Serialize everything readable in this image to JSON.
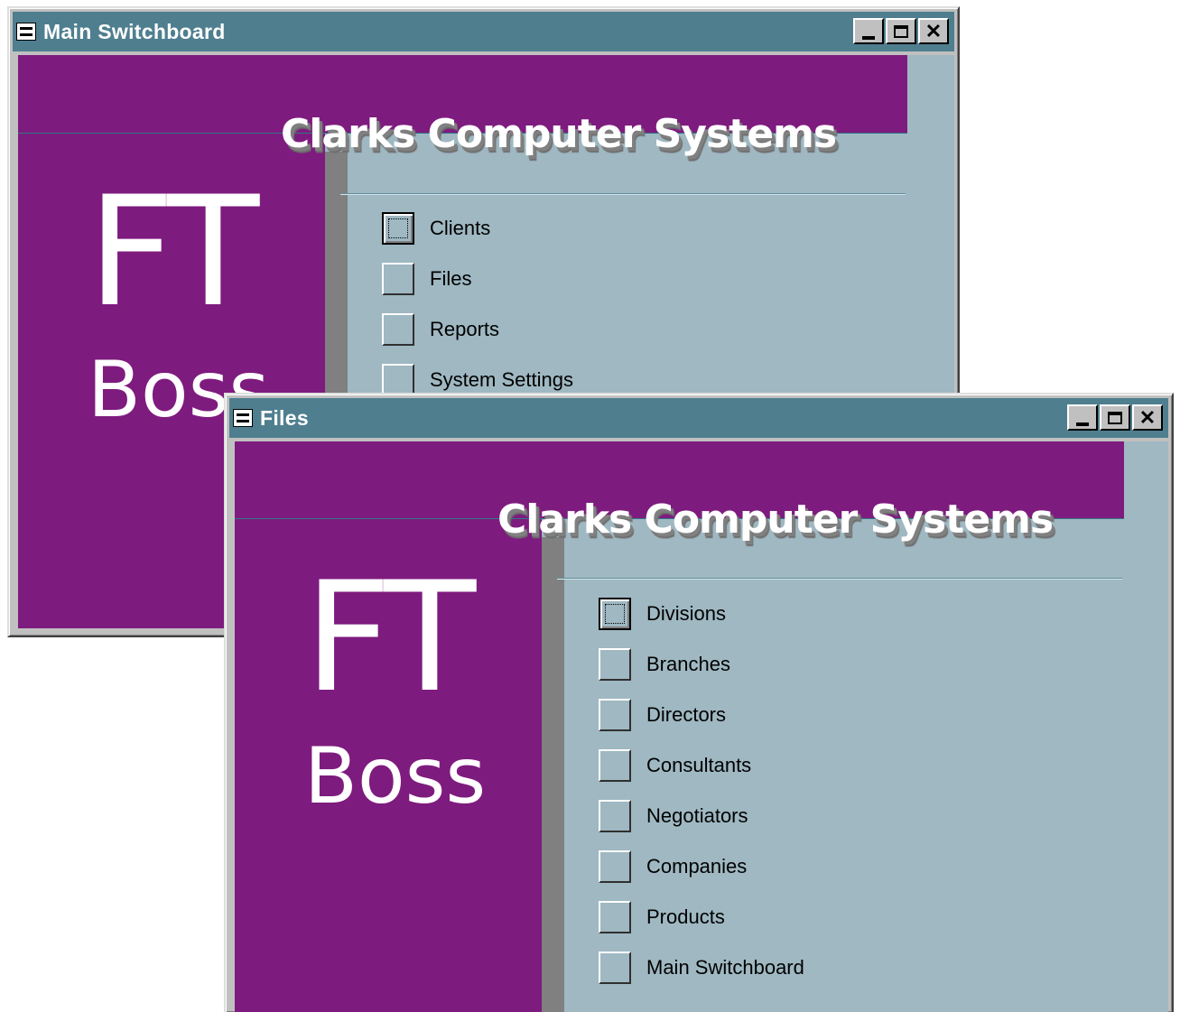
{
  "main_window": {
    "title": "Main Switchboard",
    "company": "Clarks Computer Systems",
    "logo_ft": "FT",
    "logo_boss": "Boss",
    "items": [
      {
        "label": "Clients"
      },
      {
        "label": "Files"
      },
      {
        "label": "Reports"
      },
      {
        "label": "System Settings"
      }
    ]
  },
  "files_window": {
    "title": "Files",
    "company": "Clarks Computer Systems",
    "logo_ft": "FT",
    "logo_boss": "Boss",
    "items": [
      {
        "label": "Divisions"
      },
      {
        "label": "Branches"
      },
      {
        "label": "Directors"
      },
      {
        "label": "Consultants"
      },
      {
        "label": "Negotiators"
      },
      {
        "label": "Companies"
      },
      {
        "label": "Products"
      },
      {
        "label": "Main Switchboard"
      }
    ]
  },
  "colors": {
    "title_bar": "#4f7f8f",
    "brand_purple": "#7e1b7e",
    "form_background": "#9fb8c2",
    "window_chrome": "#c0c0c0"
  },
  "icons": {
    "app": "form-icon",
    "minimize": "minimize-icon",
    "maximize": "maximize-icon",
    "close": "close-icon"
  }
}
